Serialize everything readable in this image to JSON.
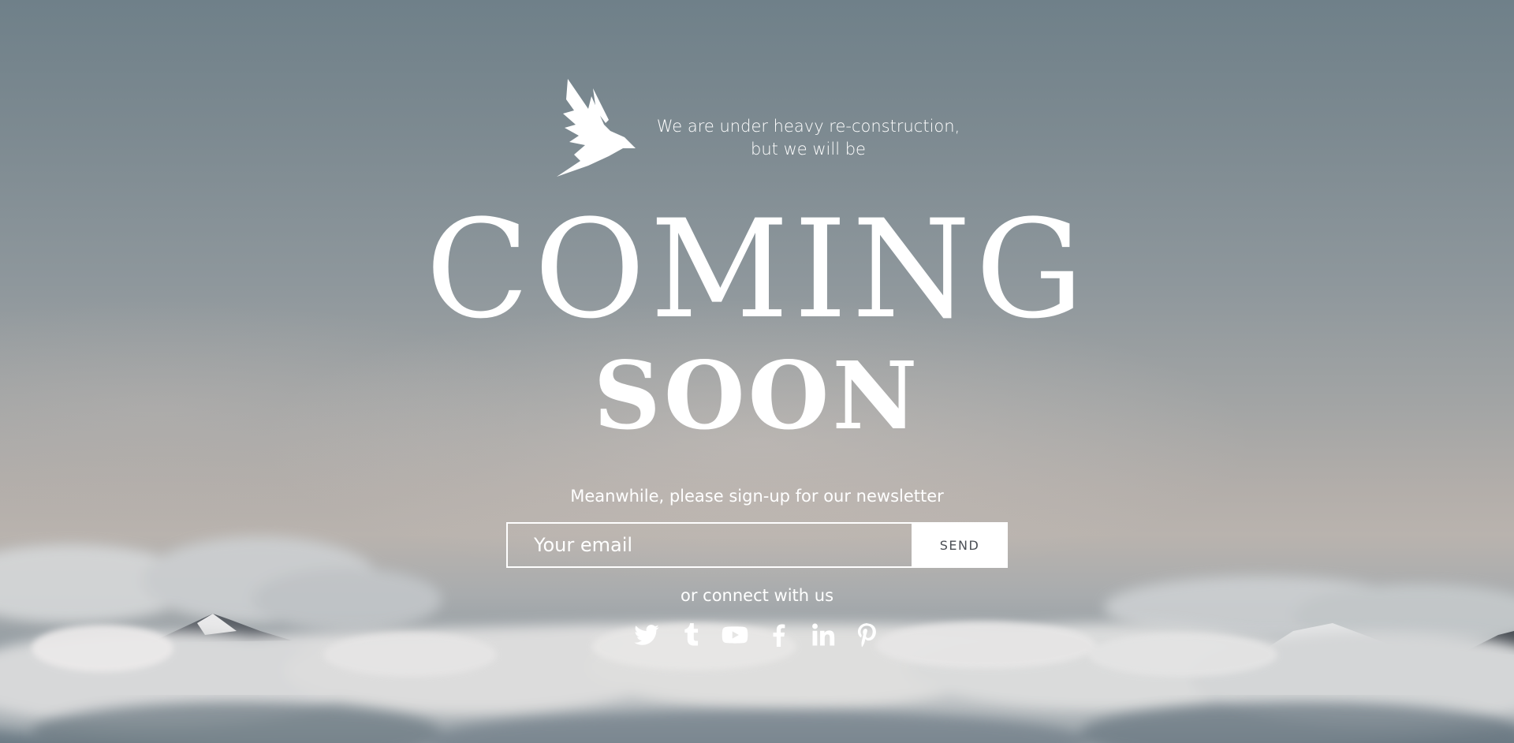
{
  "header": {
    "logo_icon": "bird-icon",
    "tagline_line1": "We are under heavy re-construction,",
    "tagline_line2": "but we will be"
  },
  "hero": {
    "headline_main": "COMING",
    "headline_sub": "SOON"
  },
  "newsletter": {
    "prompt": "Meanwhile, please sign-up for our newsletter",
    "email_placeholder": "Your email",
    "email_value": "",
    "send_label": "SEND"
  },
  "social": {
    "prompt": "or connect with us",
    "links": [
      {
        "icon": "twitter-icon",
        "label": "Twitter"
      },
      {
        "icon": "tumblr-icon",
        "label": "Tumblr"
      },
      {
        "icon": "youtube-icon",
        "label": "YouTube"
      },
      {
        "icon": "facebook-icon",
        "label": "Facebook"
      },
      {
        "icon": "linkedin-icon",
        "label": "LinkedIn"
      },
      {
        "icon": "pinterest-icon",
        "label": "Pinterest"
      }
    ]
  },
  "colors": {
    "text": "#ffffff",
    "button_bg": "#ffffff",
    "button_text": "#4b4f55",
    "sky_top": "#6f8089",
    "sky_horizon": "#b9b3ae"
  }
}
